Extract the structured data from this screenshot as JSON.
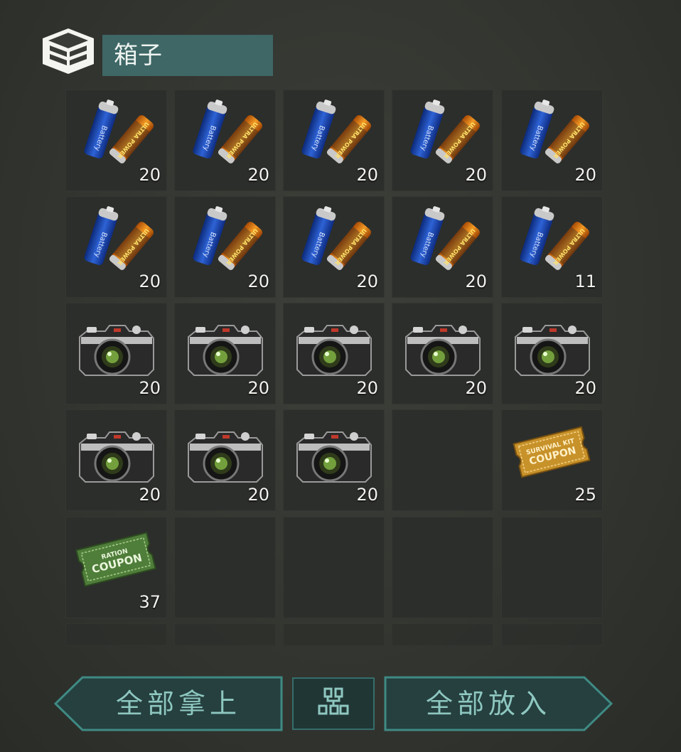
{
  "container": {
    "title": "箱子",
    "icon": "box-icon"
  },
  "slots": [
    {
      "item": "battery",
      "qty": "20"
    },
    {
      "item": "battery",
      "qty": "20"
    },
    {
      "item": "battery",
      "qty": "20"
    },
    {
      "item": "battery",
      "qty": "20"
    },
    {
      "item": "battery",
      "qty": "20"
    },
    {
      "item": "battery",
      "qty": "20"
    },
    {
      "item": "battery",
      "qty": "20"
    },
    {
      "item": "battery",
      "qty": "20"
    },
    {
      "item": "battery",
      "qty": "20"
    },
    {
      "item": "battery",
      "qty": "11"
    },
    {
      "item": "camera",
      "qty": "20"
    },
    {
      "item": "camera",
      "qty": "20"
    },
    {
      "item": "camera",
      "qty": "20"
    },
    {
      "item": "camera",
      "qty": "20"
    },
    {
      "item": "camera",
      "qty": "20"
    },
    {
      "item": "camera",
      "qty": "20"
    },
    {
      "item": "camera",
      "qty": "20"
    },
    {
      "item": "camera",
      "qty": "20"
    },
    {
      "item": null,
      "qty": null
    },
    {
      "item": "survival-kit-coupon",
      "qty": "25"
    },
    {
      "item": "ration-coupon",
      "qty": "37"
    },
    {
      "item": null,
      "qty": null
    },
    {
      "item": null,
      "qty": null
    },
    {
      "item": null,
      "qty": null
    },
    {
      "item": null,
      "qty": null
    }
  ],
  "item_art": {
    "battery": {
      "blue_text": "Battery",
      "orange_text": "ULTRA POWER"
    },
    "survival-kit-coupon": {
      "line1": "SURVIVAL KIT",
      "line2": "COUPON"
    },
    "ration-coupon": {
      "line1": "RATION",
      "line2": "COUPON"
    }
  },
  "buttons": {
    "take_all": "全部拿上",
    "sort_icon": "grid-sort-icon",
    "put_all": "全部放入"
  },
  "colors": {
    "title_bg": "#3e6766",
    "button_bg": "#25403f",
    "button_border": "#3f8a84",
    "button_text": "#8ec7c0"
  }
}
